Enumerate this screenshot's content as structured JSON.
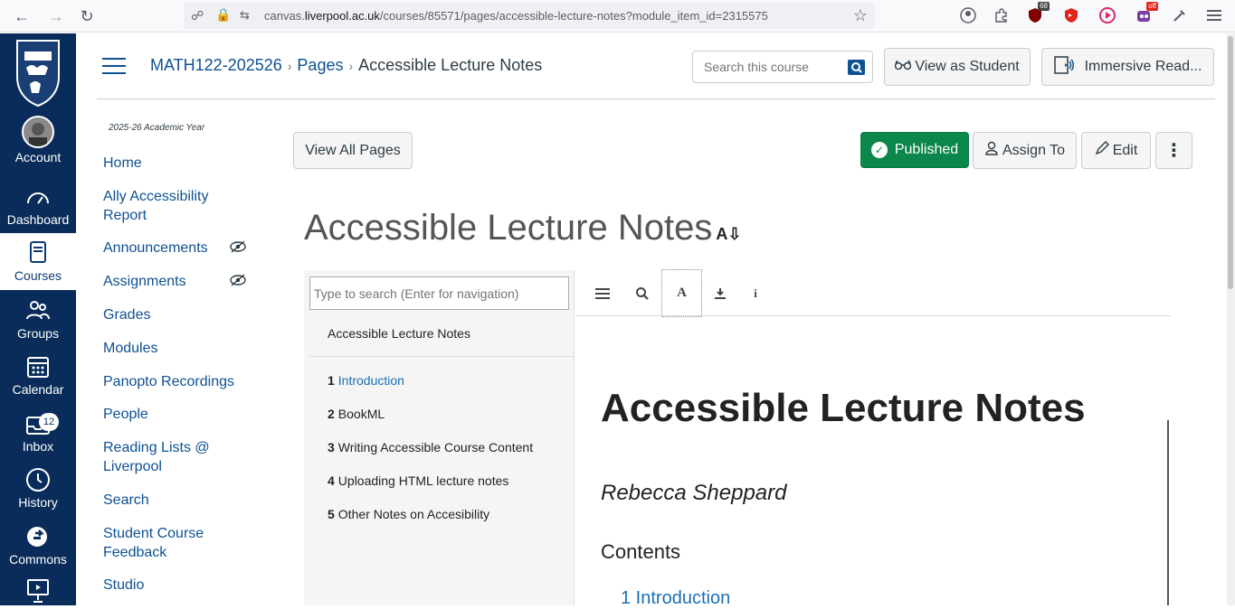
{
  "browser": {
    "url_prefix": "canvas.",
    "url_domain": "liverpool.ac.uk",
    "url_path": "/courses/85571/pages/accessible-lecture-notes?module_item_id=2315575",
    "ext_badge_1": "68",
    "ext_badge_2": "off"
  },
  "global_nav": {
    "items": [
      {
        "label": "Account"
      },
      {
        "label": "Dashboard"
      },
      {
        "label": "Courses"
      },
      {
        "label": "Groups"
      },
      {
        "label": "Calendar"
      },
      {
        "label": "Inbox",
        "badge": "12"
      },
      {
        "label": "History"
      },
      {
        "label": "Commons"
      }
    ]
  },
  "header": {
    "breadcrumb": [
      "MATH122-202526",
      "Pages",
      "Accessible Lecture Notes"
    ],
    "search_placeholder": "Search this course",
    "view_as_student": "View as Student",
    "immersive_reader": "Immersive Read..."
  },
  "course_nav": {
    "academic_year": "2025-26 Academic Year",
    "items": [
      "Home",
      "Ally Accessibility Report",
      "Announcements",
      "Assignments",
      "Grades",
      "Modules",
      "Panopto Recordings",
      "People",
      "Reading Lists @ Liverpool",
      "Search",
      "Student Course Feedback",
      "Studio"
    ]
  },
  "page": {
    "view_all_pages": "View All Pages",
    "published": "Published",
    "assign_to": "Assign To",
    "edit": "Edit",
    "title": "Accessible Lecture Notes"
  },
  "viewer": {
    "search_placeholder": "Type to search (Enter for navigation)",
    "toc_title": "Accessible Lecture Notes",
    "toc": [
      {
        "num": "1",
        "text": "Introduction"
      },
      {
        "num": "2",
        "text": "BookML"
      },
      {
        "num": "3",
        "text": "Writing Accessible Course Content"
      },
      {
        "num": "4",
        "text": "Uploading HTML lecture notes"
      },
      {
        "num": "5",
        "text": "Other Notes on Accesibility"
      }
    ],
    "doc_title": "Accessible Lecture Notes",
    "author": "Rebecca Sheppard",
    "contents_heading": "Contents",
    "first_link": "1 Introduction"
  },
  "colors": {
    "nav_bg": "#0a2c5a",
    "link": "#0d5192",
    "published": "#0b874b"
  }
}
